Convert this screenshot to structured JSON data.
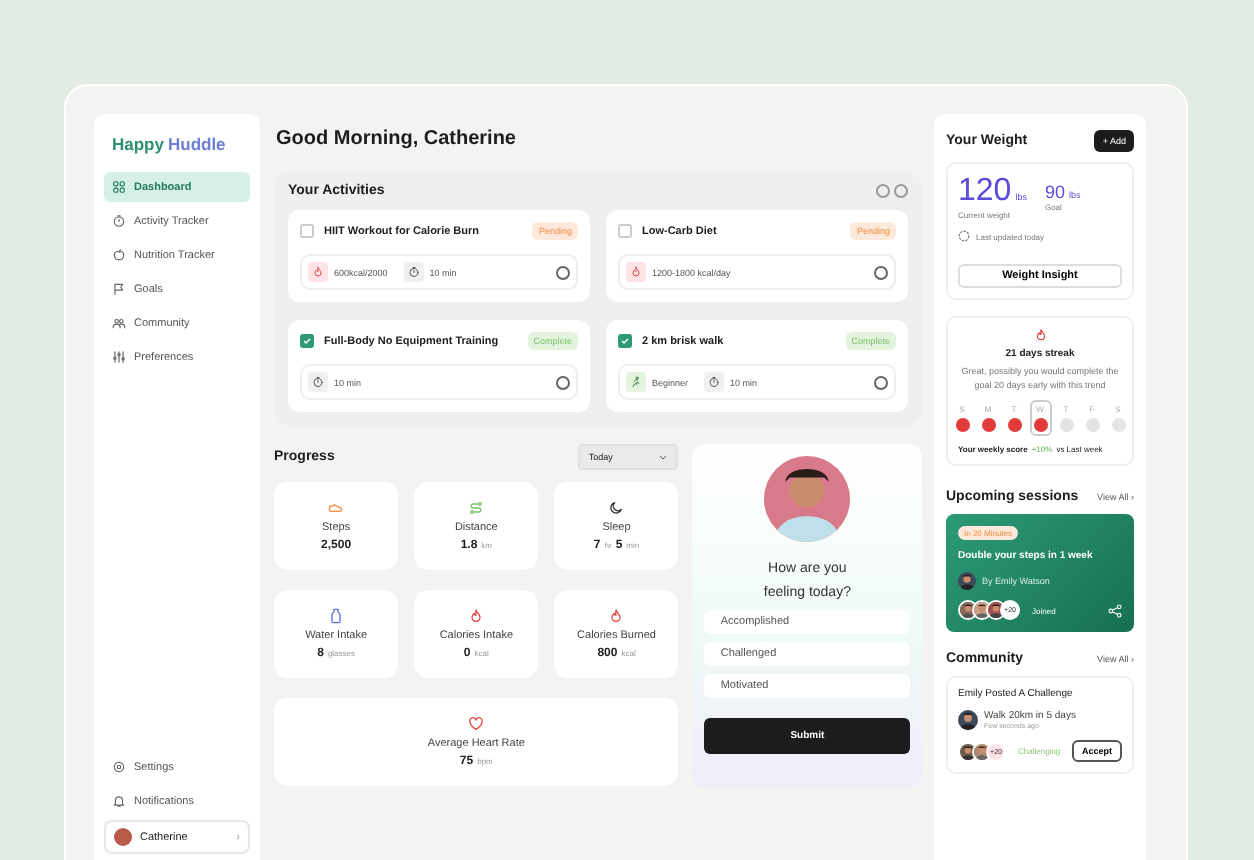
{
  "sidebar": {
    "brand": [
      "Happy",
      "Huddle"
    ],
    "items": [
      {
        "label": "Dashboard",
        "selected": true
      },
      {
        "label": "Activity Tracker",
        "selected": false
      },
      {
        "label": "Nutrition Tracker",
        "selected": false
      },
      {
        "label": "Goals",
        "selected": false
      },
      {
        "label": "Community",
        "selected": false
      },
      {
        "label": "Preferences",
        "selected": false
      }
    ],
    "bottom": [
      "Settings",
      "Notifications"
    ],
    "user": {
      "name": "Catherine",
      "caret": "›"
    }
  },
  "greeting": "Good Morning, Catherine",
  "activities": {
    "title": "Your Activities",
    "cards": [
      {
        "title": "HIIT Workout for Calorie Burn",
        "checked": false,
        "status": "Pending",
        "chips": [
          {
            "kind": "calories",
            "text": "600kcal/2000"
          },
          {
            "kind": "duration",
            "text": "10 min"
          }
        ]
      },
      {
        "title": "Low-Carb Diet",
        "checked": false,
        "status": "Pending",
        "chips": [
          {
            "kind": "calories",
            "text": "1200-1800 kcal/day"
          }
        ]
      },
      {
        "title": "Full-Body No Equipment  Training",
        "checked": true,
        "status": "Complete",
        "chips": [
          {
            "kind": "duration",
            "text": "10 min"
          }
        ]
      },
      {
        "title": "2 km brisk walk",
        "checked": true,
        "status": "Complete",
        "chips": [
          {
            "kind": "level",
            "text": "Beginner"
          },
          {
            "kind": "duration",
            "text": "10 min"
          }
        ]
      }
    ]
  },
  "progress": {
    "title": "Progress",
    "range": "Today",
    "metrics": [
      {
        "label": "Steps",
        "kind": "steps",
        "value": [
          {
            "num": "2,500"
          }
        ]
      },
      {
        "label": "Distance",
        "kind": "distance",
        "value": [
          {
            "num": "1.8",
            "unit": "km"
          }
        ]
      },
      {
        "label": "Sleep",
        "kind": "sleep",
        "value": [
          {
            "num": "7",
            "unit": "hr"
          },
          {
            "num": "5",
            "unit": "min"
          }
        ]
      },
      {
        "label": "Water Intake",
        "kind": "water",
        "value": [
          {
            "num": "8",
            "unit": "glasses"
          }
        ]
      },
      {
        "label": "Calories Intake",
        "kind": "calories",
        "value": [
          {
            "num": "0",
            "unit": "kcal"
          }
        ]
      },
      {
        "label": "Calories Burned",
        "kind": "calories",
        "value": [
          {
            "num": "800",
            "unit": "kcal"
          }
        ]
      },
      {
        "label": "Average Heart Rate",
        "kind": "heart",
        "value": [
          {
            "num": "75",
            "unit": "bpm"
          }
        ]
      }
    ]
  },
  "mood": {
    "question": "How are you feeling today?",
    "options": [
      "Accomplished",
      "Challenged",
      "Motivated"
    ],
    "submit": "Submit"
  },
  "weight": {
    "title": "Your Weight",
    "add": "+ Add",
    "current": "120",
    "current_unit": "lbs",
    "current_label": "Current weight",
    "goal": "90",
    "goal_unit": "lbs",
    "goal_label": "Goal",
    "updated": "Last updated today",
    "insight": "Weight Insight"
  },
  "streak": {
    "title": "21 days streak",
    "text": "Great, possibly you would complete the goal 20 days early with this trend",
    "days": [
      {
        "label": "S",
        "done": true,
        "selected": false
      },
      {
        "label": "M",
        "done": true,
        "selected": false
      },
      {
        "label": "T",
        "done": true,
        "selected": false
      },
      {
        "label": "W",
        "done": true,
        "selected": true
      },
      {
        "label": "T",
        "done": false,
        "selected": false
      },
      {
        "label": "F",
        "done": false,
        "selected": false
      },
      {
        "label": "S",
        "done": false,
        "selected": false
      }
    ],
    "score_label": "Your weekly score",
    "score": "+10%",
    "score_suffix": "vs Last week"
  },
  "sessions": {
    "title": "Upcoming sessions",
    "view_all": "View All",
    "caret": "›",
    "badge": "In 20 Minutes",
    "name": "Double your steps in 1 week",
    "host": "By Emily Watson",
    "count": "+20",
    "joined": "Joined"
  },
  "community": {
    "title": "Community",
    "view_all": "View All",
    "caret": "›",
    "heading": "Emily Posted A Challenge",
    "post": "Walk 20km in 5 days",
    "time": "Few seconds ago",
    "count": "+20",
    "tag": "Challenging",
    "accept": "Accept"
  }
}
